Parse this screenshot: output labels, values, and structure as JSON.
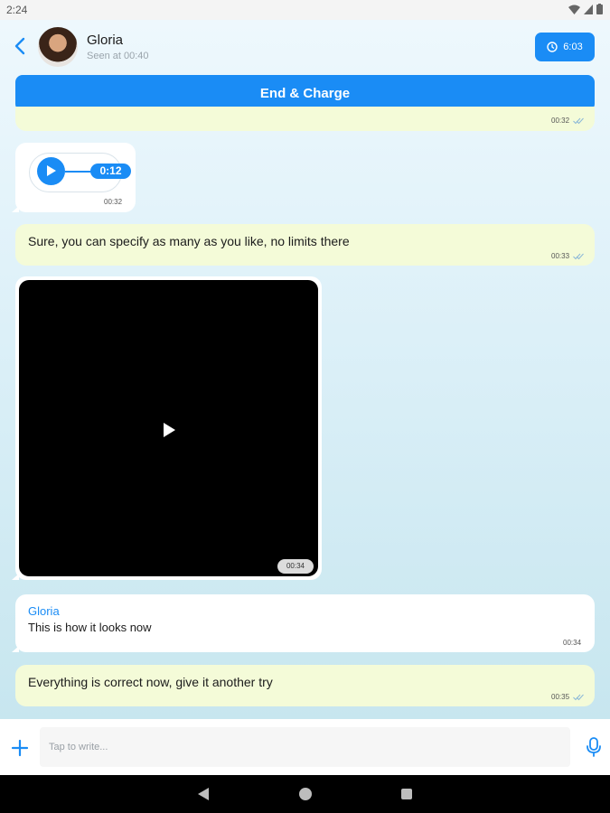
{
  "status_bar": {
    "time": "2:24"
  },
  "header": {
    "contact_name": "Gloria",
    "seen_text": "Seen at 00:40",
    "timer_label": "6:03",
    "end_charge_label": "End & Charge"
  },
  "messages": [
    {
      "type": "text",
      "direction": "out",
      "text": "",
      "time": "00:32",
      "partial": true
    },
    {
      "type": "audio",
      "direction": "in",
      "duration": "0:12",
      "time": "00:32"
    },
    {
      "type": "text",
      "direction": "out",
      "text": "Sure, you can specify as many as you like, no limits there",
      "time": "00:33"
    },
    {
      "type": "video",
      "direction": "in",
      "time": "00:34"
    },
    {
      "type": "text",
      "direction": "in",
      "sender": "Gloria",
      "text": "This is how it looks now",
      "time": "00:34"
    },
    {
      "type": "text",
      "direction": "out",
      "text": "Everything is correct now, give it another try",
      "time": "00:35"
    }
  ],
  "composer": {
    "placeholder": "Tap to write..."
  },
  "colors": {
    "accent": "#1a8cf5",
    "outgoing_bubble": "#f4fbd8",
    "incoming_bubble": "#ffffff"
  },
  "icons": [
    "wifi-icon",
    "signal-icon",
    "battery-icon",
    "back-arrow-icon",
    "clock-icon",
    "play-icon",
    "plus-icon",
    "mic-icon",
    "nav-back-icon",
    "nav-home-icon",
    "nav-recent-icon",
    "double-check-icon"
  ]
}
